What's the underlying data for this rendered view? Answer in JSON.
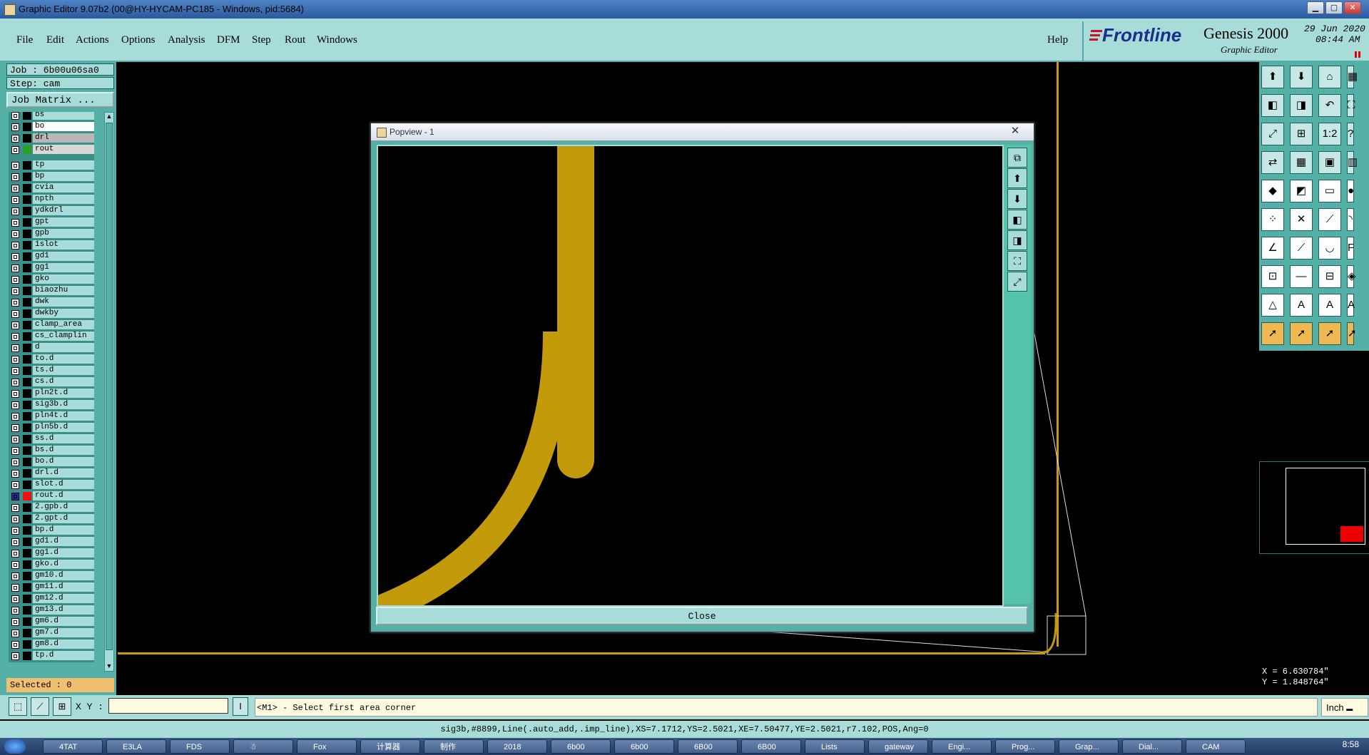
{
  "window": {
    "title": "Graphic Editor 9.07b2 (00@HY-HYCAM-PC185 - Windows, pid:5684)",
    "minimize_icon": "minimize-icon",
    "maximize_icon": "maximize-icon",
    "close_icon": "close-icon"
  },
  "menu": [
    "File",
    "Edit",
    "Actions",
    "Options",
    "Analysis",
    "DFM",
    "Step",
    "Rout",
    "Windows"
  ],
  "help_label": "Help",
  "brand": {
    "logo": "Frontline",
    "product": "Genesis 2000",
    "subtitle": "Graphic Editor",
    "date": "29 Jun 2020",
    "time": "08:44 AM"
  },
  "job": {
    "job_label": "Job : 6b00u06sa0",
    "step_label": "Step: cam",
    "matrix_button": "Job Matrix ..."
  },
  "layers": [
    {
      "name": "bs",
      "color": "#000000",
      "mark": ""
    },
    {
      "name": "bo",
      "color": "#000000",
      "mark": "",
      "highlight": "white"
    },
    {
      "name": "drl",
      "color": "#000000",
      "mark": "",
      "highlight": "gray"
    },
    {
      "name": "rout",
      "color": "#2aa02a",
      "mark": "",
      "highlight": "lightgray"
    },
    {
      "name": "tp",
      "color": "#000000",
      "mark": ""
    },
    {
      "name": "bp",
      "color": "#000000",
      "mark": ""
    },
    {
      "name": "cvia",
      "color": "#000000",
      "mark": ""
    },
    {
      "name": "npth",
      "color": "#000000",
      "mark": ""
    },
    {
      "name": "ydkdrl",
      "color": "#000000",
      "mark": ""
    },
    {
      "name": "gpt",
      "color": "#000000",
      "mark": ""
    },
    {
      "name": "gpb",
      "color": "#000000",
      "mark": ""
    },
    {
      "name": "1slot",
      "color": "#000000",
      "mark": ""
    },
    {
      "name": "gd1",
      "color": "#000000",
      "mark": "✎"
    },
    {
      "name": "gg1",
      "color": "#000000",
      "mark": ""
    },
    {
      "name": "gko",
      "color": "#000000",
      "mark": ""
    },
    {
      "name": "biaozhu",
      "color": "#000000",
      "mark": ""
    },
    {
      "name": "dwk",
      "color": "#000000",
      "mark": ""
    },
    {
      "name": "dwkby",
      "color": "#000000",
      "mark": ""
    },
    {
      "name": "clamp_area",
      "color": "#000000",
      "mark": ""
    },
    {
      "name": "cs_clamplin",
      "color": "#000000",
      "mark": ""
    },
    {
      "name": "d",
      "color": "#000000",
      "mark": ""
    },
    {
      "name": "to.d",
      "color": "#000000",
      "mark": "✎"
    },
    {
      "name": "ts.d",
      "color": "#000000",
      "mark": ""
    },
    {
      "name": "cs.d",
      "color": "#000000",
      "mark": "✎"
    },
    {
      "name": "pln2t.d",
      "color": "#000000",
      "mark": ""
    },
    {
      "name": "sig3b.d",
      "color": "#000000",
      "mark": "✎"
    },
    {
      "name": "pln4t.d",
      "color": "#000000",
      "mark": ""
    },
    {
      "name": "pln5b.d",
      "color": "#000000",
      "mark": ""
    },
    {
      "name": "ss.d",
      "color": "#000000",
      "mark": "✎"
    },
    {
      "name": "bs.d",
      "color": "#000000",
      "mark": ""
    },
    {
      "name": "bo.d",
      "color": "#000000",
      "mark": ""
    },
    {
      "name": "drl.d",
      "color": "#000000",
      "mark": ""
    },
    {
      "name": "slot.d",
      "color": "#000000",
      "mark": ""
    },
    {
      "name": "rout.d",
      "color": "#ee1111",
      "mark": "▪",
      "selected": true
    },
    {
      "name": "2.gpb.d",
      "color": "#000000",
      "mark": ""
    },
    {
      "name": "2.gpt.d",
      "color": "#000000",
      "mark": ""
    },
    {
      "name": "bp.d",
      "color": "#000000",
      "mark": ""
    },
    {
      "name": "gd1.d",
      "color": "#000000",
      "mark": "✎"
    },
    {
      "name": "gg1.d",
      "color": "#000000",
      "mark": ""
    },
    {
      "name": "gko.d",
      "color": "#000000",
      "mark": ""
    },
    {
      "name": "gm10.d",
      "color": "#000000",
      "mark": ""
    },
    {
      "name": "gm11.d",
      "color": "#000000",
      "mark": ""
    },
    {
      "name": "gm12.d",
      "color": "#000000",
      "mark": ""
    },
    {
      "name": "gm13.d",
      "color": "#000000",
      "mark": ""
    },
    {
      "name": "gm6.d",
      "color": "#000000",
      "mark": ""
    },
    {
      "name": "gm7.d",
      "color": "#000000",
      "mark": ""
    },
    {
      "name": "gm8.d",
      "color": "#000000",
      "mark": ""
    },
    {
      "name": "tp.d",
      "color": "#000000",
      "mark": ""
    }
  ],
  "selected_label": "Selected : 0",
  "popview": {
    "title": "Popview - 1",
    "close_x": "✕",
    "close_button": "Close",
    "tools": [
      "popview-fit-icon",
      "zoom-home-icon",
      "zoom-down-icon",
      "pan-left-icon",
      "pan-right-icon",
      "zoom-fit-icon",
      "zoom-all-icon"
    ]
  },
  "right_tools": {
    "icons": [
      "pan-up-icon",
      "pan-down-icon",
      "home-icon",
      "zoom-grid-icon",
      "pan-left-icon",
      "pan-right-icon",
      "undo-zoom-icon",
      "zoom-extents-icon",
      "fit-screen-icon",
      "zoom-fit-icon",
      "scale-1-2-icon",
      "help-icon",
      "snap-icon",
      "grid-icon",
      "feature-info-icon",
      "layer-info-icon",
      "pad-icon",
      "line-icon",
      "measure-icon",
      "circle-icon",
      "node-icon",
      "cross-icon",
      "segment-icon",
      "arc-icon",
      "red-angle-icon",
      "line-select-icon",
      "arc-select-icon",
      "text-icon",
      "move-icon",
      "minus-icon",
      "frame-icon",
      "shapes-icon",
      "triangle-icon",
      "triangle-a-icon",
      "triangle-b-icon",
      "triangle-c-icon",
      "pointer-icon",
      "pointer-orange-icon",
      "pointer-select-icon",
      "pointer-multi-icon"
    ],
    "labels": [
      "⬆",
      "⬇",
      "⌂",
      "▦",
      "◧",
      "◨",
      "↶",
      "⛶",
      "⤢",
      "⊞",
      "1:2",
      "?",
      "⇄",
      "▦",
      "▣",
      "▥",
      "◆",
      "◩",
      "▭",
      "●",
      "⁘",
      "✕",
      "⟋",
      "◝",
      "∠",
      "⟋",
      "◡",
      "F",
      "⊡",
      "—",
      "⊟",
      "◈",
      "△",
      "A",
      "A",
      "A",
      "➚",
      "➚",
      "➚",
      "➚"
    ]
  },
  "coords": {
    "x": "X = 6.630784\"",
    "y": "Y = 1.848764\""
  },
  "command": {
    "xy_label": "X Y :",
    "xy_value": "",
    "prompt": "<M1> - Select first area corner",
    "unit": "Inch"
  },
  "status_line": "sig3b,#8899,Line(.auto_add,.imp_line),XS=7.1712,YS=2.5021,XE=7.50477,YE=2.5021,r7.102,POS,Ang=0",
  "taskbar": {
    "items": [
      "4TAT",
      "E3LA",
      "FDS",
      "☃",
      "Fox",
      "计算器",
      "制作",
      "2018",
      "6b00",
      "6b00",
      "6B00",
      "6B00",
      "Lists",
      "gateway",
      "Engi...",
      "Prog...",
      "Grap...",
      "Dial...",
      "CAM"
    ],
    "clock": "8:58"
  },
  "colors": {
    "panel": "#a8dcd9",
    "panel_dark": "#55b0a8",
    "trace": "#c39a0a"
  }
}
